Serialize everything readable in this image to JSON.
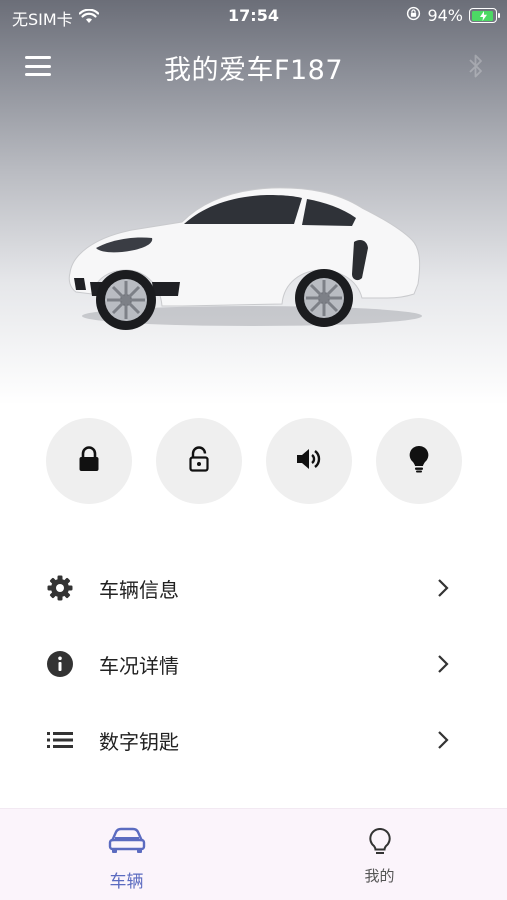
{
  "status_bar": {
    "carrier": "无SIM卡",
    "time": "17:54",
    "battery": "94%",
    "battery_level": 0.94
  },
  "header": {
    "title": "我的爱车F187",
    "menu_icon": "hamburger-menu-icon",
    "bluetooth_icon": "bluetooth-icon"
  },
  "quick_actions": [
    {
      "icon": "lock-icon",
      "name": "lock"
    },
    {
      "icon": "unlock-icon",
      "name": "unlock"
    },
    {
      "icon": "horn-speaker-icon",
      "name": "horn"
    },
    {
      "icon": "light-bulb-icon",
      "name": "lights"
    }
  ],
  "menu": {
    "items": [
      {
        "label": "车辆信息",
        "icon": "gear-icon"
      },
      {
        "label": "车况详情",
        "icon": "info-icon"
      },
      {
        "label": "数字钥匙",
        "icon": "list-icon"
      }
    ]
  },
  "tabbar": {
    "tabs": [
      {
        "label": "车辆",
        "icon": "car-icon",
        "active": true
      },
      {
        "label": "我的",
        "icon": "lightbulb-outline-icon",
        "active": false
      }
    ]
  },
  "colors": {
    "accent": "#5b6bc0",
    "tabbar_bg": "#fbf4fb",
    "action_bg": "#efefef",
    "battery": "#4cd964"
  }
}
